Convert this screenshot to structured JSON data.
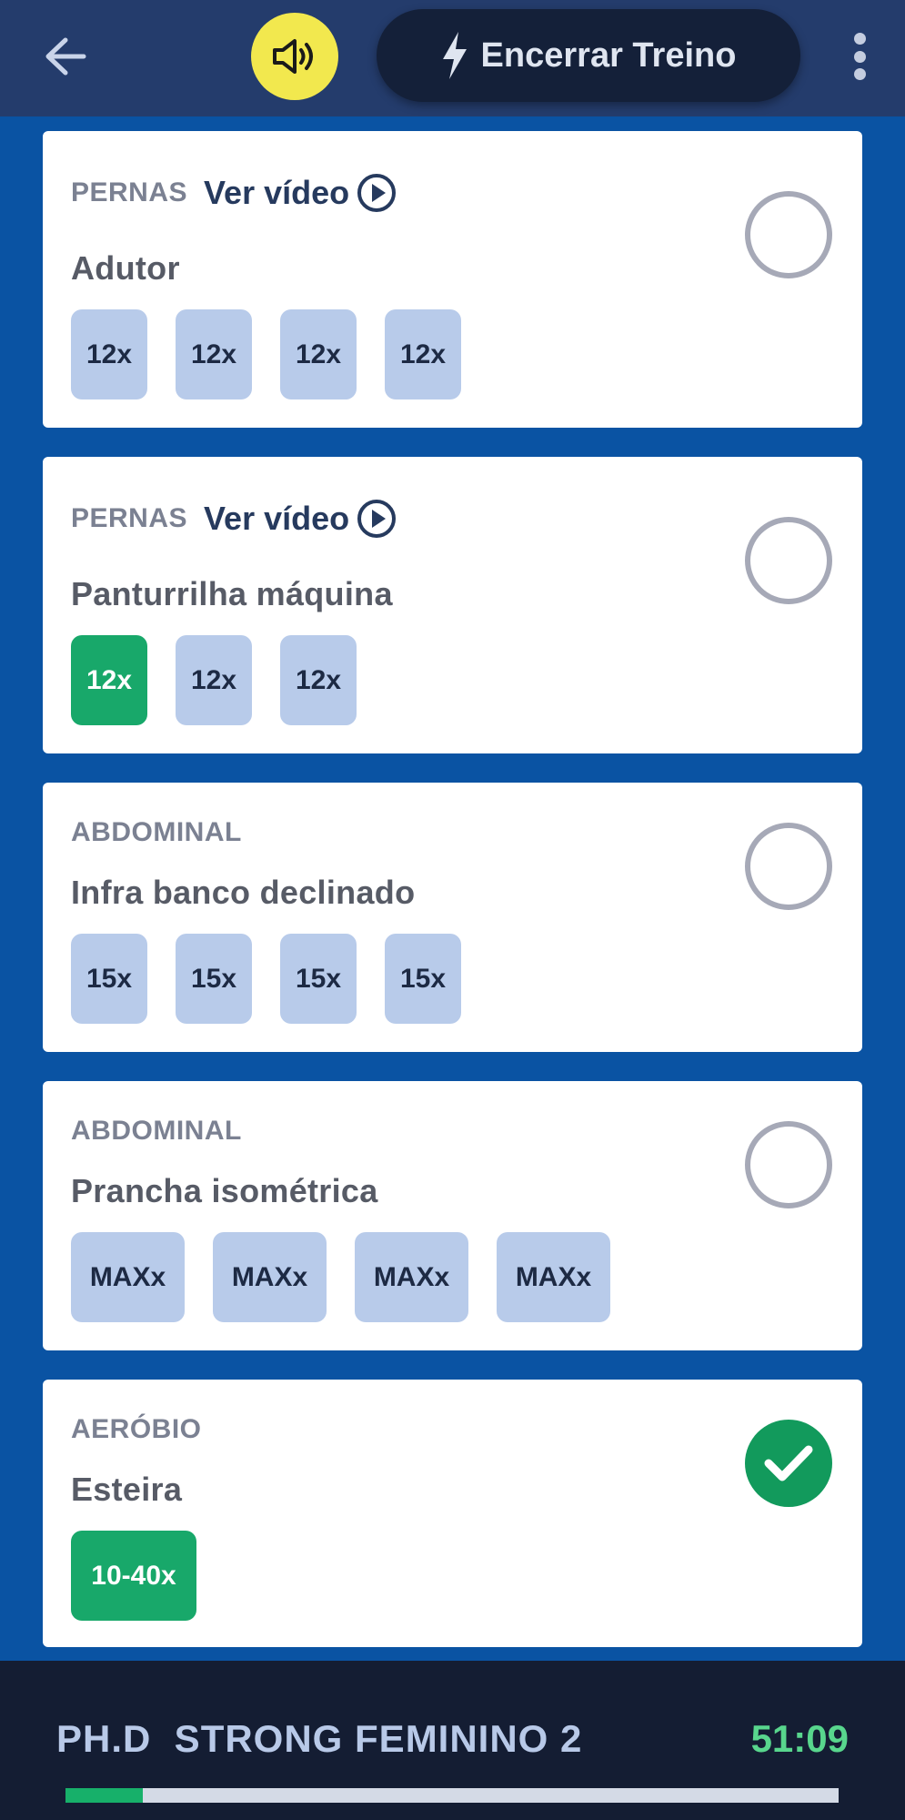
{
  "header": {
    "back_icon": "arrow-left-icon",
    "sound_icon": "speaker-volume-icon",
    "end_label": "Encerrar Treino",
    "end_icon": "lightning-bolt-icon",
    "menu_icon": "more-vertical-icon",
    "colors": {
      "bar": "#243c6c",
      "sound": "#f2e84e",
      "end": "#142039"
    }
  },
  "exercises": [
    {
      "category": "PERNAS",
      "video_label": "Ver vídeo",
      "name": "Adutor",
      "sets": [
        "12x",
        "12x",
        "12x",
        "12x"
      ],
      "done_sets": 0,
      "completed": false
    },
    {
      "category": "PERNAS",
      "video_label": "Ver vídeo",
      "name": "Panturrilha máquina",
      "sets": [
        "12x",
        "12x",
        "12x"
      ],
      "done_sets": 1,
      "completed": false
    },
    {
      "category": "ABDOMINAL",
      "name": "Infra banco declinado",
      "sets": [
        "15x",
        "15x",
        "15x",
        "15x"
      ],
      "done_sets": 0,
      "completed": false
    },
    {
      "category": "ABDOMINAL",
      "name": "Prancha isométrica",
      "sets": [
        "MAXx",
        "MAXx",
        "MAXx",
        "MAXx"
      ],
      "done_sets": 0,
      "completed": false
    },
    {
      "category": "AERÓBIO",
      "name": "Esteira",
      "sets": [
        "10-40x"
      ],
      "done_sets": 1,
      "completed": true
    }
  ],
  "footer": {
    "workout_name": "PH.D  STRONG FEMININO 2",
    "timer": "51:09",
    "progress": 0.1,
    "colors": {
      "background": "#141d33",
      "timer": "#58d68d",
      "progress": "#17b06a"
    }
  },
  "colors": {
    "background": "#0a53a3",
    "set_pending": "#b8cbea",
    "set_done": "#18a86a",
    "check_done": "#129a5c"
  }
}
